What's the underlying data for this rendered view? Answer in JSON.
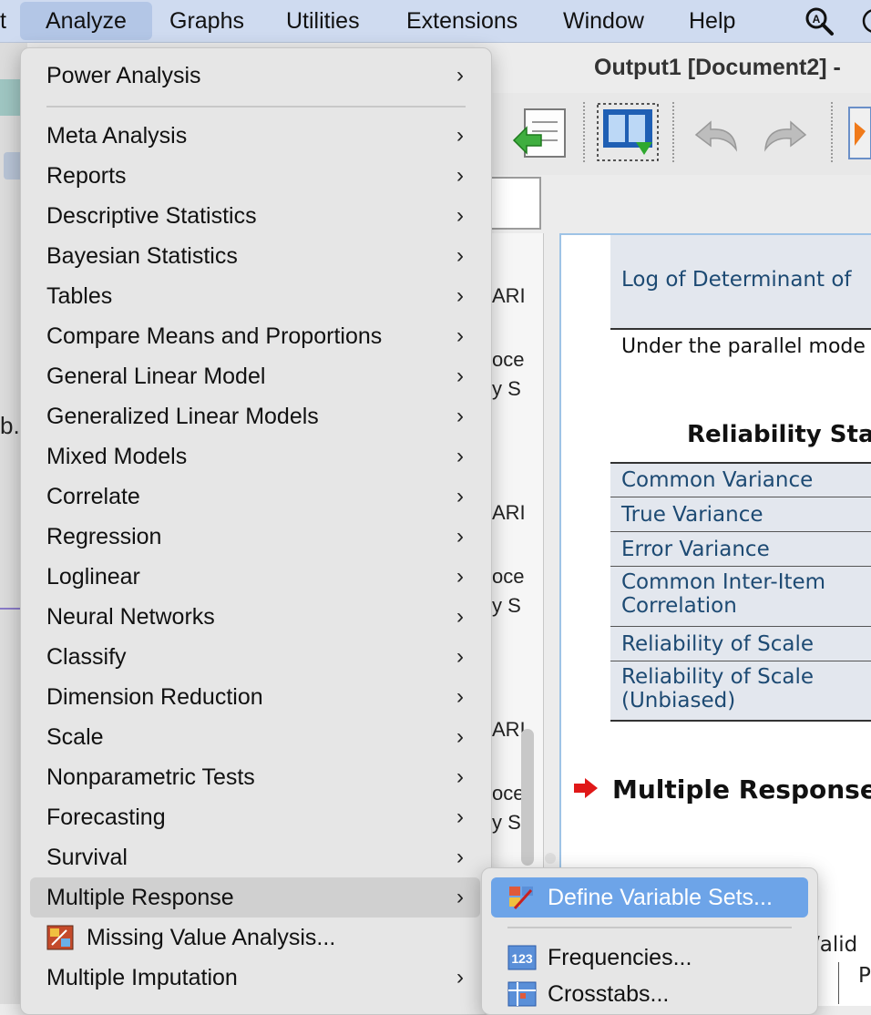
{
  "menubar": {
    "items": [
      "t",
      "Analyze",
      "Graphs",
      "Utilities",
      "Extensions",
      "Window",
      "Help"
    ],
    "active_index": 1,
    "search_icon": "search-icon"
  },
  "window": {
    "title": "Output1 [Document2] -"
  },
  "navigator_fragments": {
    "f1": "ARI",
    "f2": "oce",
    "f3": "y S",
    "f4": "ARI",
    "f5": "oce",
    "f6": "y S",
    "f7": "ARI",
    "f8": "oce",
    "f9": "y S"
  },
  "left_fragment": "b.",
  "output": {
    "log_det_label": "Log of Determinant of",
    "parallel_note": "Under the parallel mode",
    "reliability_title": "Reliability Sta",
    "rows": [
      "Common Variance",
      "True Variance",
      "Error Variance",
      "Common Inter-Item",
      "Correlation",
      "Reliability of Scale",
      "Reliability of Scale",
      "(Unbiased)"
    ],
    "multiple_response_heading": "Multiple Response",
    "valid_fragment": "/alid",
    "p_fragment": "P"
  },
  "analyze_menu": {
    "items": [
      {
        "label": "Power Analysis",
        "submenu": true
      },
      {
        "label": "Meta Analysis",
        "submenu": true
      },
      {
        "label": "Reports",
        "submenu": true
      },
      {
        "label": "Descriptive Statistics",
        "submenu": true
      },
      {
        "label": "Bayesian Statistics",
        "submenu": true
      },
      {
        "label": "Tables",
        "submenu": true
      },
      {
        "label": "Compare Means and Proportions",
        "submenu": true
      },
      {
        "label": "General Linear Model",
        "submenu": true
      },
      {
        "label": "Generalized Linear Models",
        "submenu": true
      },
      {
        "label": "Mixed Models",
        "submenu": true
      },
      {
        "label": "Correlate",
        "submenu": true
      },
      {
        "label": "Regression",
        "submenu": true
      },
      {
        "label": "Loglinear",
        "submenu": true
      },
      {
        "label": "Neural Networks",
        "submenu": true
      },
      {
        "label": "Classify",
        "submenu": true
      },
      {
        "label": "Dimension Reduction",
        "submenu": true
      },
      {
        "label": "Scale",
        "submenu": true
      },
      {
        "label": "Nonparametric Tests",
        "submenu": true
      },
      {
        "label": "Forecasting",
        "submenu": true
      },
      {
        "label": "Survival",
        "submenu": true
      },
      {
        "label": "Multiple Response",
        "submenu": true
      },
      {
        "label": "Missing Value Analysis...",
        "submenu": false
      },
      {
        "label": "Multiple Imputation",
        "submenu": true
      }
    ],
    "hovered": "Multiple Response",
    "chevron": "›"
  },
  "multiple_response_submenu": {
    "items": [
      {
        "label": "Define Variable Sets...",
        "icon": "define-sets-icon"
      },
      {
        "label": "Frequencies...",
        "icon": "frequencies-icon"
      },
      {
        "label": "Crosstabs...",
        "icon": "crosstabs-icon"
      }
    ],
    "active": "Define Variable Sets..."
  },
  "colors": {
    "menubar_bg": "#cfdbf0",
    "menu_bg": "#e6e6e6",
    "highlight": "#6da4e8",
    "table_label": "#1d4a73",
    "arrow_red": "#e01818"
  }
}
